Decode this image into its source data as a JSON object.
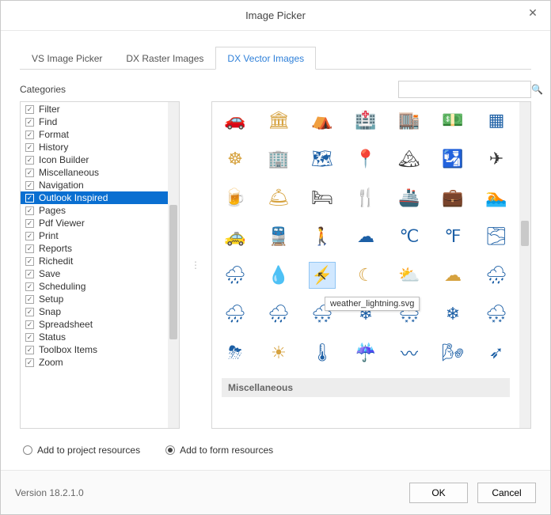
{
  "window": {
    "title": "Image Picker"
  },
  "tabs": [
    {
      "label": "VS Image Picker",
      "active": false
    },
    {
      "label": "DX Raster Images",
      "active": false
    },
    {
      "label": "DX Vector Images",
      "active": true
    }
  ],
  "categories_label": "Categories",
  "search": {
    "placeholder": "",
    "value": ""
  },
  "categories": [
    {
      "label": "Filter",
      "checked": true,
      "selected": false
    },
    {
      "label": "Find",
      "checked": true,
      "selected": false
    },
    {
      "label": "Format",
      "checked": true,
      "selected": false
    },
    {
      "label": "History",
      "checked": true,
      "selected": false
    },
    {
      "label": "Icon Builder",
      "checked": true,
      "selected": false
    },
    {
      "label": "Miscellaneous",
      "checked": true,
      "selected": false
    },
    {
      "label": "Navigation",
      "checked": true,
      "selected": false
    },
    {
      "label": "Outlook Inspired",
      "checked": true,
      "selected": true
    },
    {
      "label": "Pages",
      "checked": true,
      "selected": false
    },
    {
      "label": "Pdf Viewer",
      "checked": true,
      "selected": false
    },
    {
      "label": "Print",
      "checked": true,
      "selected": false
    },
    {
      "label": "Reports",
      "checked": true,
      "selected": false
    },
    {
      "label": "Richedit",
      "checked": true,
      "selected": false
    },
    {
      "label": "Save",
      "checked": true,
      "selected": false
    },
    {
      "label": "Scheduling",
      "checked": true,
      "selected": false
    },
    {
      "label": "Setup",
      "checked": true,
      "selected": false
    },
    {
      "label": "Snap",
      "checked": true,
      "selected": false
    },
    {
      "label": "Spreadsheet",
      "checked": true,
      "selected": false
    },
    {
      "label": "Status",
      "checked": true,
      "selected": false
    },
    {
      "label": "Toolbox Items",
      "checked": true,
      "selected": false
    },
    {
      "label": "Zoom",
      "checked": true,
      "selected": false
    }
  ],
  "grid": {
    "tooltip": "weather_lightning.svg",
    "separator": "Miscellaneous",
    "rows": [
      [
        {
          "name": "car-icon",
          "glyph": "🚗",
          "color": "c-red"
        },
        {
          "name": "column-icon",
          "glyph": "🏛",
          "color": "c-gold"
        },
        {
          "name": "tent-icon",
          "glyph": "⛺",
          "color": "c-gold"
        },
        {
          "name": "hospital-icon",
          "glyph": "🏥",
          "color": "c-green"
        },
        {
          "name": "store-icon",
          "glyph": "🏬",
          "color": "c-green"
        },
        {
          "name": "money-icon",
          "glyph": "💵",
          "color": "c-green"
        },
        {
          "name": "reserved-icon",
          "glyph": "▦",
          "color": "c-blue"
        }
      ],
      [
        {
          "name": "ship-wheel-icon",
          "glyph": "☸",
          "color": "c-gold"
        },
        {
          "name": "office-icon",
          "glyph": "🏢",
          "color": "c-dark"
        },
        {
          "name": "map-icon",
          "glyph": "🗺",
          "color": "c-blue"
        },
        {
          "name": "pin-icon",
          "glyph": "📍",
          "color": "c-red"
        },
        {
          "name": "mountain-icon",
          "glyph": "🏔",
          "color": "c-dark"
        },
        {
          "name": "passport-icon",
          "glyph": "🛂",
          "color": "c-blue"
        },
        {
          "name": "plane-icon",
          "glyph": "✈",
          "color": "c-dark"
        }
      ],
      [
        {
          "name": "beer-icon",
          "glyph": "🍺",
          "color": "c-dark"
        },
        {
          "name": "dish-icon",
          "glyph": "🛎",
          "color": "c-gold"
        },
        {
          "name": "bed-icon",
          "glyph": "🛏",
          "color": "c-dark"
        },
        {
          "name": "cutlery-icon",
          "glyph": "🍴",
          "color": "c-dark"
        },
        {
          "name": "ship-icon",
          "glyph": "🚢",
          "color": "c-blue"
        },
        {
          "name": "briefcase-icon",
          "glyph": "💼",
          "color": "c-blue"
        },
        {
          "name": "swim-icon",
          "glyph": "🏊",
          "color": "c-blue"
        }
      ],
      [
        {
          "name": "taxi-icon",
          "glyph": "🚕",
          "color": "c-gold"
        },
        {
          "name": "train-icon",
          "glyph": "🚆",
          "color": "c-blue"
        },
        {
          "name": "walk-icon",
          "glyph": "🚶",
          "color": "c-dark"
        },
        {
          "name": "cloud-icon",
          "glyph": "☁",
          "color": "c-blue"
        },
        {
          "name": "celsius-icon",
          "glyph": "℃",
          "color": "c-blue"
        },
        {
          "name": "fahrenheit-icon",
          "glyph": "℉",
          "color": "c-blue"
        },
        {
          "name": "fog-icon",
          "glyph": "🌫",
          "color": "c-blue"
        }
      ],
      [
        {
          "name": "hail-icon",
          "glyph": "🌧",
          "color": "c-blue"
        },
        {
          "name": "drop-icon",
          "glyph": "💧",
          "color": "c-blue"
        },
        {
          "name": "lightning-icon",
          "glyph": "⚡",
          "color": "c-gold",
          "selected": true
        },
        {
          "name": "moon-icon",
          "glyph": "☾",
          "color": "c-gold"
        },
        {
          "name": "partly-cloud-icon",
          "glyph": "⛅",
          "color": "c-gold"
        },
        {
          "name": "partly-cloud-night-icon",
          "glyph": "☁",
          "color": "c-gold"
        },
        {
          "name": "rain-heavy-icon",
          "glyph": "🌧",
          "color": "c-blue"
        }
      ],
      [
        {
          "name": "drizzle-icon",
          "glyph": "🌧",
          "color": "c-blue"
        },
        {
          "name": "showers-icon",
          "glyph": "🌧",
          "color": "c-blue"
        },
        {
          "name": "sleet-icon",
          "glyph": "🌨",
          "color": "c-blue"
        },
        {
          "name": "snow1-icon",
          "glyph": "❄",
          "color": "c-blue"
        },
        {
          "name": "snow2-icon",
          "glyph": "🌨",
          "color": "c-blue"
        },
        {
          "name": "snow3-icon",
          "glyph": "❄",
          "color": "c-blue"
        },
        {
          "name": "snow4-icon",
          "glyph": "🌨",
          "color": "c-blue"
        }
      ],
      [
        {
          "name": "storm-icon",
          "glyph": "⛈",
          "color": "c-blue"
        },
        {
          "name": "sun-icon",
          "glyph": "☀",
          "color": "c-gold"
        },
        {
          "name": "thermometer-icon",
          "glyph": "🌡",
          "color": "c-blue"
        },
        {
          "name": "umbrella-icon",
          "glyph": "☔",
          "color": "c-red"
        },
        {
          "name": "waves-icon",
          "glyph": "〰",
          "color": "c-blue"
        },
        {
          "name": "wind-icon",
          "glyph": "🌬",
          "color": "c-blue"
        },
        {
          "name": "compass-icon",
          "glyph": "➶",
          "color": "c-blue"
        }
      ]
    ]
  },
  "options": {
    "add_project": "Add to project resources",
    "add_form": "Add to form resources",
    "selected": "form"
  },
  "footer": {
    "version": "Version 18.2.1.0",
    "ok": "OK",
    "cancel": "Cancel"
  }
}
